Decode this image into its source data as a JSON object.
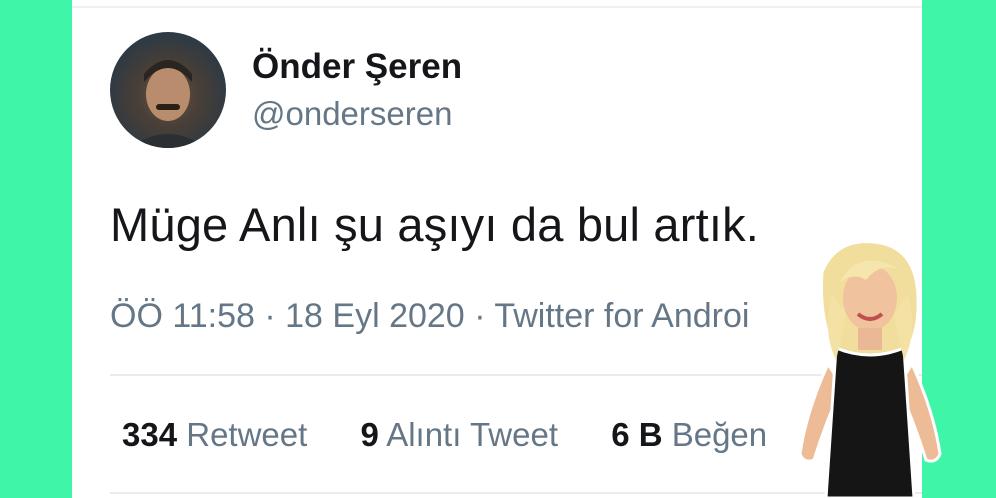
{
  "tweet": {
    "author": {
      "name": "Önder Şeren",
      "handle": "@onderseren"
    },
    "text": "Müge Anlı şu aşıyı da bul artık.",
    "meta": {
      "time": "ÖÖ 11:58",
      "separator": "·",
      "date": "18 Eyl 2020",
      "source": "Twitter for Androi"
    },
    "stats": {
      "retweets": {
        "count": "334",
        "label": "Retweet"
      },
      "quotes": {
        "count": "9",
        "label": "Alıntı Tweet"
      },
      "likes": {
        "count": "6 B",
        "label": "Beğen"
      }
    }
  },
  "colors": {
    "background": "#3ef5a8",
    "card": "#ffffff",
    "text_primary": "#141619",
    "text_secondary": "#657786"
  }
}
